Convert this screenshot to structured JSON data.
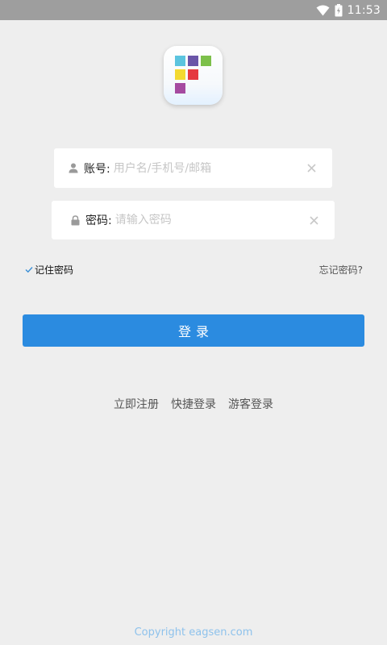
{
  "status_bar": {
    "time": "11:53",
    "icons": [
      "wifi-icon",
      "battery-icon"
    ]
  },
  "logo": {
    "squares": [
      {
        "color": "#5bc4df"
      },
      {
        "color": "#6a55a8"
      },
      {
        "color": "#7cc04a"
      },
      {
        "color": "#f3d930"
      },
      {
        "color": "#e5393f"
      },
      {
        "color": "#a54aa0"
      }
    ]
  },
  "form": {
    "account": {
      "label": "账号:",
      "placeholder": "用户名/手机号/邮箱",
      "value": "",
      "icon": "user-icon"
    },
    "password": {
      "label": "密码:",
      "placeholder": "请输入密码",
      "value": "",
      "icon": "lock-icon"
    },
    "remember_label": "记住密码",
    "remember_checked": true,
    "forgot_label": "忘记密码?",
    "login_label": "登录"
  },
  "links": {
    "register": "立即注册",
    "quick_login": "快捷登录",
    "guest_login": "游客登录"
  },
  "footer": {
    "copyright": "Copyright eagsen.com"
  },
  "colors": {
    "background": "#eeeeee",
    "status_bar": "#9e9e9e",
    "primary": "#2b8be0",
    "copyright": "#8ec2ec"
  }
}
